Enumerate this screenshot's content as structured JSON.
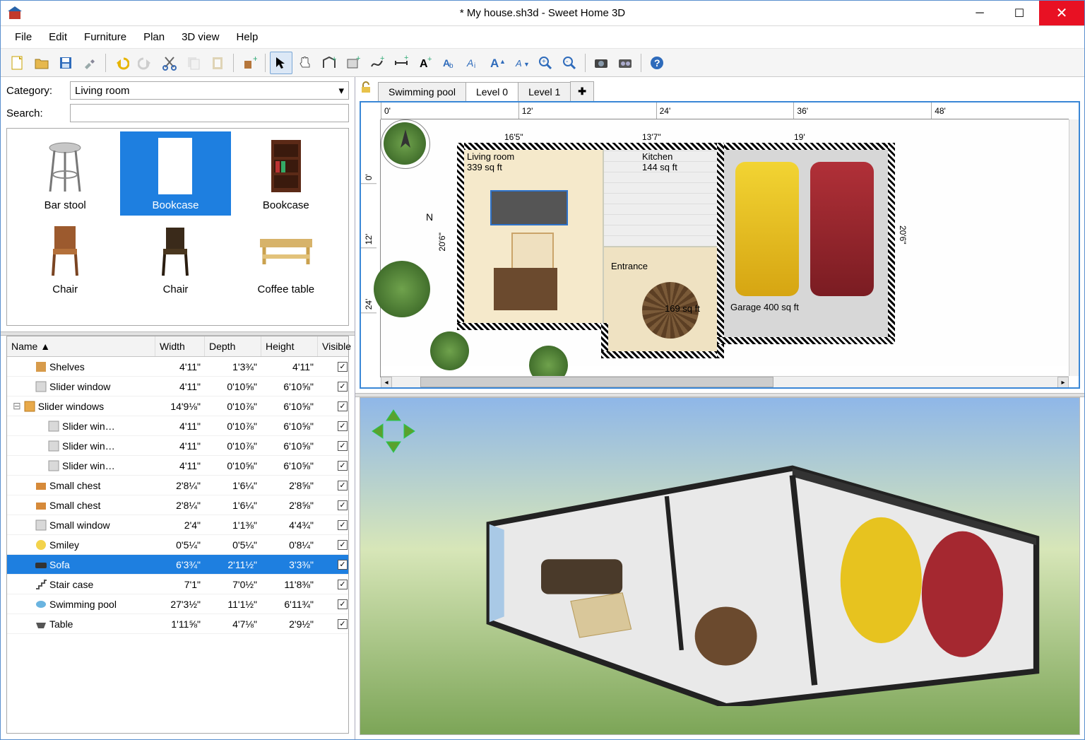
{
  "window": {
    "title": "* My house.sh3d - Sweet Home 3D"
  },
  "menu": [
    "File",
    "Edit",
    "Furniture",
    "Plan",
    "3D view",
    "Help"
  ],
  "catalog": {
    "category_label": "Category:",
    "category_value": "Living room",
    "search_label": "Search:",
    "search_value": "",
    "items": [
      {
        "name": "Bar stool"
      },
      {
        "name": "Bookcase",
        "selected": true
      },
      {
        "name": "Bookcase"
      },
      {
        "name": "Chair"
      },
      {
        "name": "Chair"
      },
      {
        "name": "Coffee table"
      }
    ]
  },
  "furniture_table": {
    "headers": {
      "name": "Name ▲",
      "width": "Width",
      "depth": "Depth",
      "height": "Height",
      "visible": "Visible"
    },
    "rows": [
      {
        "indent": 1,
        "icon": "shelves",
        "name": "Shelves",
        "w": "4'11\"",
        "d": "1'3¾\"",
        "h": "4'11\"",
        "v": true
      },
      {
        "indent": 1,
        "icon": "window",
        "name": "Slider window",
        "w": "4'11\"",
        "d": "0'10⅝\"",
        "h": "6'10⅝\"",
        "v": true
      },
      {
        "indent": 0,
        "icon": "group",
        "expander": "minus",
        "name": "Slider windows",
        "w": "14'9⅛\"",
        "d": "0'10⅞\"",
        "h": "6'10⅝\"",
        "v": true
      },
      {
        "indent": 2,
        "icon": "window",
        "name": "Slider win…",
        "w": "4'11\"",
        "d": "0'10⅞\"",
        "h": "6'10⅝\"",
        "v": true
      },
      {
        "indent": 2,
        "icon": "window",
        "name": "Slider win…",
        "w": "4'11\"",
        "d": "0'10⅞\"",
        "h": "6'10⅝\"",
        "v": true
      },
      {
        "indent": 2,
        "icon": "window",
        "name": "Slider win…",
        "w": "4'11\"",
        "d": "0'10⅝\"",
        "h": "6'10⅝\"",
        "v": true
      },
      {
        "indent": 1,
        "icon": "chest",
        "name": "Small chest",
        "w": "2'8¼\"",
        "d": "1'6¼\"",
        "h": "2'8⅝\"",
        "v": true
      },
      {
        "indent": 1,
        "icon": "chest",
        "name": "Small chest",
        "w": "2'8¼\"",
        "d": "1'6¼\"",
        "h": "2'8⅝\"",
        "v": true
      },
      {
        "indent": 1,
        "icon": "window",
        "name": "Small window",
        "w": "2'4\"",
        "d": "1'1⅜\"",
        "h": "4'4¾\"",
        "v": true
      },
      {
        "indent": 1,
        "icon": "smiley",
        "name": "Smiley",
        "w": "0'5¼\"",
        "d": "0'5¼\"",
        "h": "0'8¼\"",
        "v": true
      },
      {
        "indent": 1,
        "icon": "sofa",
        "name": "Sofa",
        "w": "6'3¾\"",
        "d": "2'11½\"",
        "h": "3'3⅜\"",
        "v": true,
        "selected": true
      },
      {
        "indent": 1,
        "icon": "stair",
        "name": "Stair case",
        "w": "7'1\"",
        "d": "7'0½\"",
        "h": "11'8⅜\"",
        "v": true
      },
      {
        "indent": 1,
        "icon": "pool",
        "name": "Swimming pool",
        "w": "27'3½\"",
        "d": "11'1½\"",
        "h": "6'11¾\"",
        "v": true
      },
      {
        "indent": 1,
        "icon": "table",
        "name": "Table",
        "w": "1'11⅝\"",
        "d": "4'7⅛\"",
        "h": "2'9½\"",
        "v": true
      }
    ]
  },
  "plan": {
    "tabs": [
      "Swimming pool",
      "Level 0",
      "Level 1"
    ],
    "active_tab": 1,
    "ruler_top": [
      "0'",
      "12'",
      "24'",
      "36'",
      "48'"
    ],
    "ruler_left": [
      "0'",
      "12'",
      "24'"
    ],
    "dims": {
      "w1": "16'5\"",
      "w2": "13'7\"",
      "w3": "19'",
      "h1": "20'6\"",
      "h2": "20'6\""
    },
    "rooms": {
      "living": "Living room\n339 sq ft",
      "kitchen": "Kitchen\n144 sq ft",
      "entrance": "Entrance",
      "entrance_area": "169 sq ft",
      "garage": "Garage 400 sq ft"
    },
    "compass": "N"
  }
}
